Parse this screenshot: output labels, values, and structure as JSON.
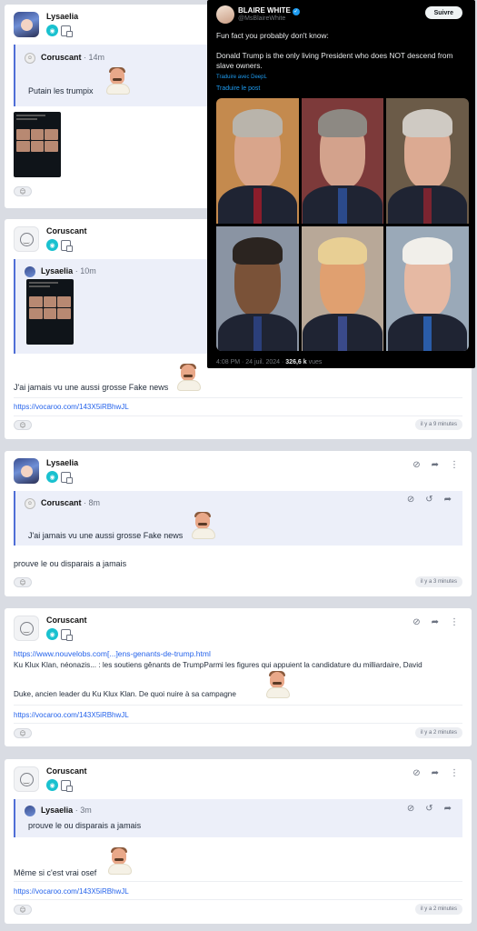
{
  "post1": {
    "user": "Lysaelia",
    "quote": {
      "user": "Coruscant",
      "time": "· 14m",
      "text": "Putain les trumpix"
    }
  },
  "tweet": {
    "name": "BLAIRE WHITE",
    "handle": "@MsBlaireWhite",
    "follow_label": "Suivre",
    "line1": "Fun fact you probably don't know:",
    "line2": "Donald Trump is the only living President who does NOT descend from slave owners.",
    "translated_by": "Traduire avec DeepL",
    "translate_label": "Traduire le post",
    "meta_time": "4:08 PM · 24 juil. 2024 ·",
    "meta_views": "326,6 k",
    "meta_views_label": "vues",
    "photo_colors": {
      "p1_bg": "#c48a4e",
      "p2_bg": "#7d3a3a",
      "p3_bg": "#6b5b48",
      "p4_bg": "#8a94a3",
      "p5_bg": "#b8a898",
      "p6_bg": "#9aa9b8"
    }
  },
  "post2": {
    "user": "Coruscant",
    "quote": {
      "user": "Lysaelia",
      "time": "· 10m"
    },
    "text": "J'ai jamais vu une aussi grosse Fake news",
    "link": "https://vocaroo.com/143X5iRBhwJL",
    "timestamp": "il y a 9 minutes"
  },
  "post3": {
    "user": "Lysaelia",
    "quote": {
      "user": "Coruscant",
      "time": "· 8m",
      "text": "J'ai jamais vu une aussi grosse Fake news"
    },
    "text": "prouve le ou disparais a jamais",
    "timestamp": "il y a 3 minutes"
  },
  "post4": {
    "user": "Coruscant",
    "link1": "https://www.nouvelobs.com[...]ens-genants-de-trump.html",
    "text1": "Ku Klux Klan, néonazis... : les soutiens gênants de TrumpParmi les figures qui appuient la candidature du milliardaire, David",
    "text2": "Duke, ancien leader du Ku Klux Klan. De quoi nuire à sa campagne",
    "link2": "https://vocaroo.com/143X5iRBhwJL",
    "timestamp": "il y a 2 minutes"
  },
  "post5": {
    "user": "Coruscant",
    "quote": {
      "user": "Lysaelia",
      "time": "· 3m",
      "text": "prouve le ou disparais a jamais"
    },
    "text": "Même si c'est vrai osef",
    "link": "https://vocaroo.com/143X5iRBhwJL",
    "timestamp": "il y a 2 minutes"
  }
}
